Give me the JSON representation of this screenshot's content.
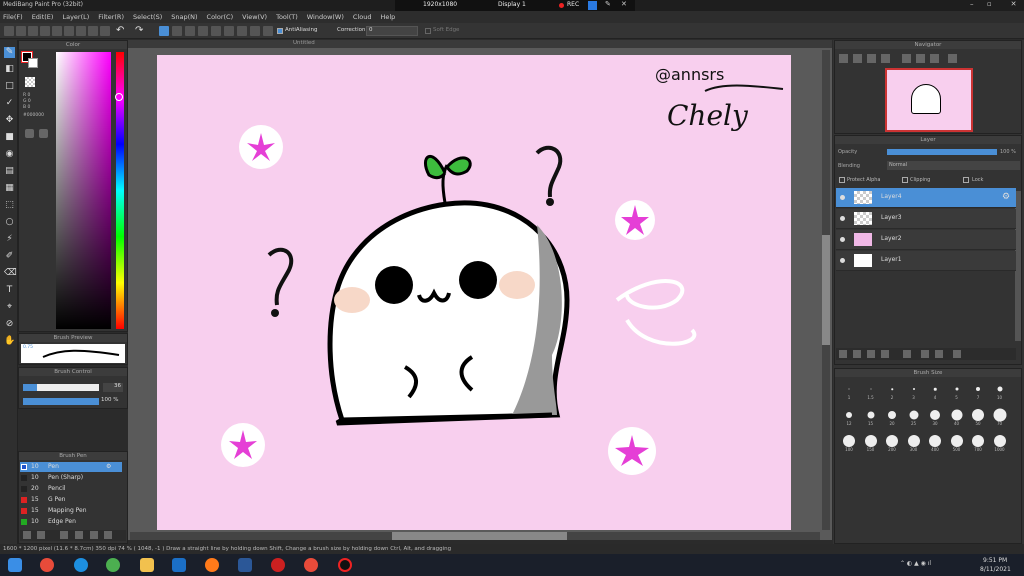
{
  "window": {
    "title": "MediBang Paint Pro (32bit)",
    "recorder_resolution": "1920x1080",
    "recorder_display": "Display 1",
    "recorder_status": "REC"
  },
  "menu": [
    "File(F)",
    "Edit(E)",
    "Layer(L)",
    "Filter(R)",
    "Select(S)",
    "Snap(N)",
    "Color(C)",
    "View(V)",
    "Tool(T)",
    "Window(W)",
    "Cloud",
    "Help"
  ],
  "toolbar": {
    "antialiasing": "AntiAliasing",
    "correction_label": "Correction",
    "correction_value": "0",
    "soft_edge": "Soft Edge"
  },
  "document": {
    "tab": "Untitled"
  },
  "color_panel": {
    "title": "Color",
    "r": "R 0",
    "g": "G 0",
    "b": "B 0",
    "hex": "#000000"
  },
  "brush_preview": {
    "title": "Brush Preview",
    "size": "0.75"
  },
  "brush_control": {
    "title": "Brush Control",
    "size": "36",
    "opacity": "100 %"
  },
  "brush_panel": {
    "title": "Brush Pen",
    "items": [
      {
        "size": "10",
        "name": "Pen",
        "color": "#2255cc"
      },
      {
        "size": "10",
        "name": "Pen (Sharp)",
        "color": "#222222"
      },
      {
        "size": "20",
        "name": "Pencil",
        "color": "#222222"
      },
      {
        "size": "15",
        "name": "G Pen",
        "color": "#dd2222"
      },
      {
        "size": "15",
        "name": "Mapping Pen",
        "color": "#dd2222"
      },
      {
        "size": "10",
        "name": "Edge Pen",
        "color": "#22aa22"
      }
    ]
  },
  "navigator": {
    "title": "Navigator"
  },
  "layer_panel": {
    "title": "Layer",
    "opacity_label": "Opacity",
    "opacity_value": "100 %",
    "blending_label": "Blending",
    "blending_value": "Normal",
    "protect_alpha": "Protect Alpha",
    "clipping": "Clipping",
    "lock": "Lock",
    "layers": [
      "Layer4",
      "Layer3",
      "Layer2",
      "Layer1"
    ]
  },
  "brush_size": {
    "title": "Brush Size",
    "row1": [
      "1",
      "1.5",
      "2",
      "3",
      "4",
      "5",
      "7",
      "10"
    ],
    "row2": [
      "12",
      "15",
      "20",
      "25",
      "30",
      "40",
      "50",
      "70"
    ],
    "row3": [
      "100",
      "150",
      "200",
      "300",
      "400",
      "500",
      "700",
      "1000"
    ]
  },
  "artwork": {
    "signature_line1": "@annsrs",
    "signature_line2": "Chely"
  },
  "status": {
    "text": "1600 * 1200 pixel  (11.6 * 8.7cm)  350 dpi  74 %  ( 1048, -1 )  Draw a straight line by holding down Shift, Change a brush size by holding down Ctrl, Alt, and dragging"
  },
  "taskbar": {
    "time": "9:51 PM",
    "date": "8/11/2021"
  }
}
